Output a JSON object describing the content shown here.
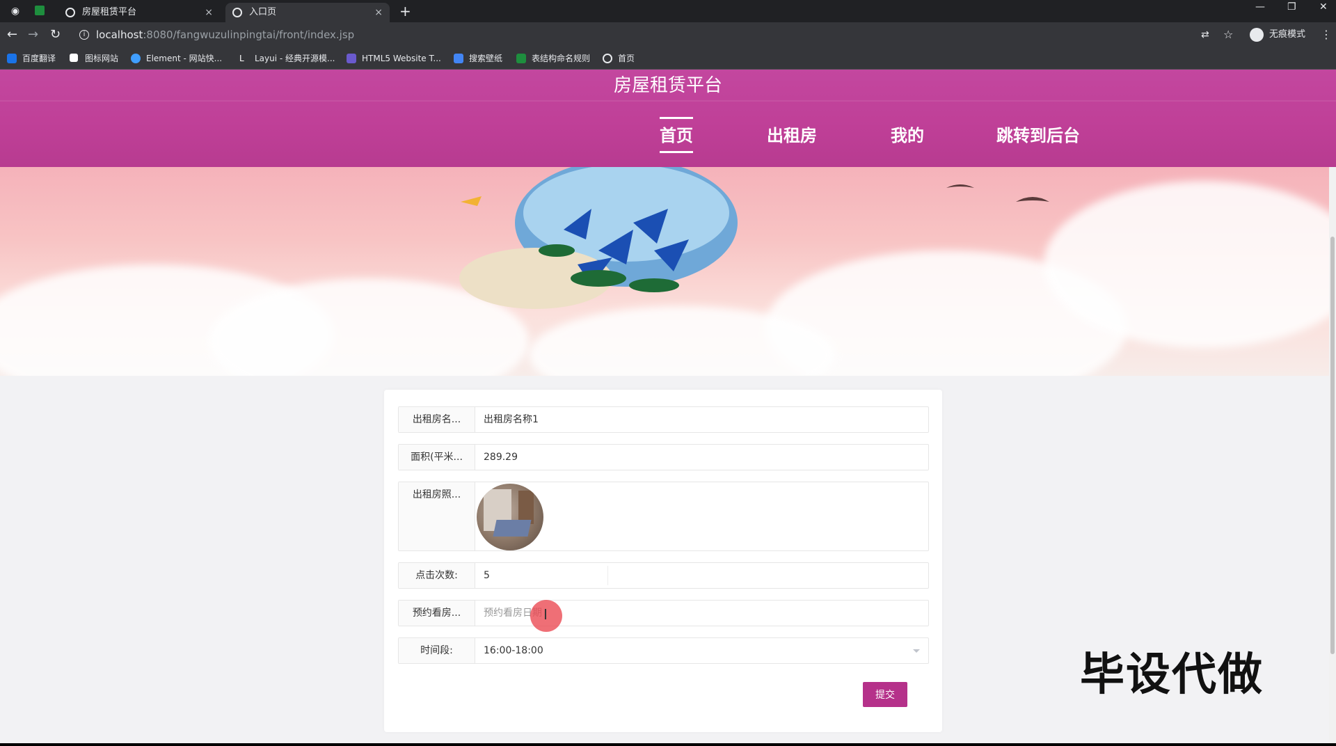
{
  "browser": {
    "tabs": [
      {
        "title": "房屋租赁平台",
        "close": "×"
      },
      {
        "title": "入口页",
        "close": "×"
      }
    ],
    "new_tab": "+",
    "url_host": "localhost",
    "url_path": ":8080/fangwuzulinpingtai/front/index.jsp",
    "incognito_label": "无痕模式",
    "bookmarks": [
      {
        "label": "百度翻译",
        "color": "#1a73e8"
      },
      {
        "label": "图标网站",
        "color": "#ffffff"
      },
      {
        "label": "Element - 网站快...",
        "color": "#409eff"
      },
      {
        "label": "Layui - 经典开源模...",
        "color": "#ffffff"
      },
      {
        "label": "HTML5 Website T...",
        "color": "#6a5acd"
      },
      {
        "label": "搜索壁纸",
        "color": "#4285f4"
      },
      {
        "label": "表结构命名规则",
        "color": "#1e8e3e"
      },
      {
        "label": "首页",
        "color": "#e8eaed"
      }
    ],
    "icons": [
      "back-icon",
      "forward-icon",
      "reload-icon",
      "info-icon",
      "translate-icon",
      "star-icon",
      "menu-icon",
      "minimize-icon",
      "restore-icon",
      "close-icon"
    ]
  },
  "site": {
    "title": "房屋租赁平台",
    "nav": [
      "首页",
      "出租房",
      "我的",
      "跳转到后台"
    ],
    "accent": "#bf3f97"
  },
  "form": {
    "fields": [
      {
        "label": "出租房名...",
        "value": "出租房名称1"
      },
      {
        "label": "面积(平米...",
        "value": "289.29"
      },
      {
        "label": "出租房照...",
        "value": ""
      },
      {
        "label": "点击次数:",
        "value": "5"
      },
      {
        "label": "预约看房...",
        "placeholder": "预约看房日期"
      },
      {
        "label": "时间段:",
        "value": "16:00-18:00"
      }
    ],
    "submit_label": "提交"
  },
  "watermark": "毕设代做"
}
